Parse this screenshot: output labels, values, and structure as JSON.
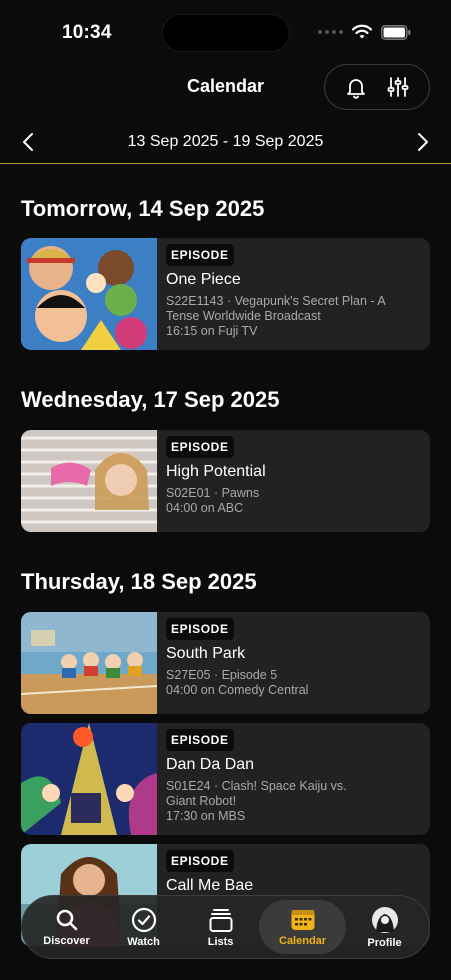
{
  "status": {
    "time": "10:34"
  },
  "header": {
    "title": "Calendar"
  },
  "week": {
    "range": "13 Sep 2025 - 19 Sep 2025"
  },
  "days": [
    {
      "heading": "Tomorrow, 14 Sep 2025",
      "items": [
        {
          "badge": "EPISODE",
          "title": "One Piece",
          "line1": "S22E1143 · Vegapunk's Secret Plan - A",
          "line2": "Tense Worldwide Broadcast",
          "line3": "16:15 on Fuji TV"
        }
      ]
    },
    {
      "heading": "Wednesday, 17 Sep 2025",
      "items": [
        {
          "badge": "EPISODE",
          "title": "High Potential",
          "line1": "S02E01 · Pawns",
          "line2": "04:00 on ABC"
        }
      ]
    },
    {
      "heading": "Thursday, 18 Sep 2025",
      "items": [
        {
          "badge": "EPISODE",
          "title": "South Park",
          "line1": "S27E05 · Episode 5",
          "line2": "04:00 on Comedy Central"
        },
        {
          "badge": "EPISODE",
          "title": "Dan Da Dan",
          "line1": "S01E24 · Clash! Space Kaiju vs.",
          "line2": "Giant Robot!",
          "line3": "17:30 on MBS"
        },
        {
          "badge": "EPISODE",
          "title": "Call Me Bae"
        }
      ]
    }
  ],
  "tabs": {
    "discover": "Discover",
    "watch": "Watch",
    "lists": "Lists",
    "calendar": "Calendar",
    "profile": "Profile"
  },
  "colors": {
    "accent": "#f0b418",
    "divider": "#b8912c",
    "card": "#222222",
    "background": "#0b0b0b"
  }
}
